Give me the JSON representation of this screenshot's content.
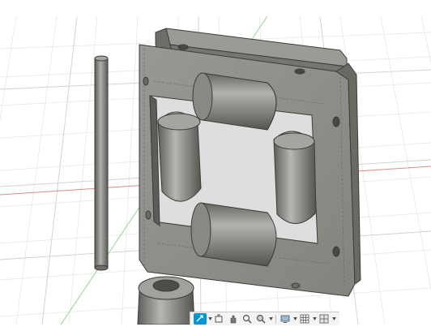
{
  "viewport": {
    "background": "#ffffff",
    "grid_minor_color": "#e4e4e4",
    "grid_major_color": "#cfcfcf",
    "axis_x_color": "#e28b8b",
    "axis_z_color": "#8fd68f",
    "model_fill": "#8e8c86",
    "model_edge": "#3c3c3a"
  },
  "toolbar": {
    "accent": "#0696d7",
    "buttons": [
      {
        "id": "orbit",
        "icon": "orbit-icon",
        "active": true
      },
      {
        "id": "look-at",
        "icon": "look-at-icon",
        "active": false
      },
      {
        "id": "pan",
        "icon": "pan-icon",
        "active": false
      },
      {
        "id": "zoom",
        "icon": "zoom-icon",
        "active": false
      },
      {
        "id": "fit",
        "icon": "zoom-window-icon",
        "active": false
      },
      {
        "id": "display-settings",
        "icon": "display-settings-icon",
        "active": false
      },
      {
        "id": "grid-snaps",
        "icon": "grid-icon",
        "active": false
      },
      {
        "id": "viewports",
        "icon": "viewports-icon",
        "active": false
      }
    ]
  }
}
